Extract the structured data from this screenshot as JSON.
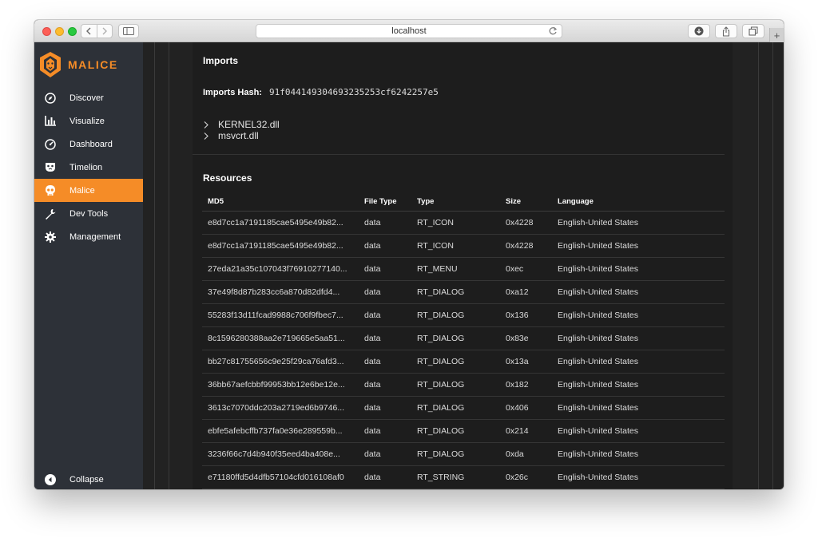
{
  "browser": {
    "url": "localhost"
  },
  "sidebar": {
    "brand": "MALICE",
    "items": [
      {
        "label": "Discover",
        "icon": "compass-icon"
      },
      {
        "label": "Visualize",
        "icon": "bar-chart-icon"
      },
      {
        "label": "Dashboard",
        "icon": "gauge-icon"
      },
      {
        "label": "Timelion",
        "icon": "timelion-mask-icon"
      },
      {
        "label": "Malice",
        "icon": "skull-icon"
      },
      {
        "label": "Dev Tools",
        "icon": "wrench-icon"
      },
      {
        "label": "Management",
        "icon": "gear-icon"
      }
    ],
    "active_item": "Malice",
    "collapse_label": "Collapse"
  },
  "imports": {
    "title": "Imports",
    "hash_label": "Imports Hash:",
    "hash_value": "91f044149304693235253cf6242257e5",
    "dlls": [
      "KERNEL32.dll",
      "msvcrt.dll"
    ]
  },
  "resources": {
    "title": "Resources",
    "columns": [
      "MD5",
      "File Type",
      "Type",
      "Size",
      "Language"
    ],
    "rows": [
      [
        "e8d7cc1a7191185cae5495e49b82...",
        "data",
        "RT_ICON",
        "0x4228",
        "English-United States"
      ],
      [
        "e8d7cc1a7191185cae5495e49b82...",
        "data",
        "RT_ICON",
        "0x4228",
        "English-United States"
      ],
      [
        "27eda21a35c107043f76910277140...",
        "data",
        "RT_MENU",
        "0xec",
        "English-United States"
      ],
      [
        "37e49f8d87b283cc6a870d82dfd4...",
        "data",
        "RT_DIALOG",
        "0xa12",
        "English-United States"
      ],
      [
        "55283f13d11fcad9988c706f9fbec7...",
        "data",
        "RT_DIALOG",
        "0x136",
        "English-United States"
      ],
      [
        "8c1596280388aa2e719665e5aa51...",
        "data",
        "RT_DIALOG",
        "0x83e",
        "English-United States"
      ],
      [
        "bb27c81755656c9e25f29ca76afd3...",
        "data",
        "RT_DIALOG",
        "0x13a",
        "English-United States"
      ],
      [
        "36bb67aefcbbf99953bb12e6be12e...",
        "data",
        "RT_DIALOG",
        "0x182",
        "English-United States"
      ],
      [
        "3613c7070ddc203a2719ed6b9746...",
        "data",
        "RT_DIALOG",
        "0x406",
        "English-United States"
      ],
      [
        "ebfe5afebcffb737fa0e36e289559b...",
        "data",
        "RT_DIALOG",
        "0x214",
        "English-United States"
      ],
      [
        "3236f66c7d4b940f35eed4ba408e...",
        "data",
        "RT_DIALOG",
        "0xda",
        "English-United States"
      ],
      [
        "e71180ffd5d4dfb57104cfd016108af0",
        "data",
        "RT_STRING",
        "0x26c",
        "English-United States"
      ]
    ]
  },
  "colors": {
    "accent": "#f58c27",
    "sidebar_bg": "#2d3138",
    "content_bg": "#1d1d1d"
  }
}
